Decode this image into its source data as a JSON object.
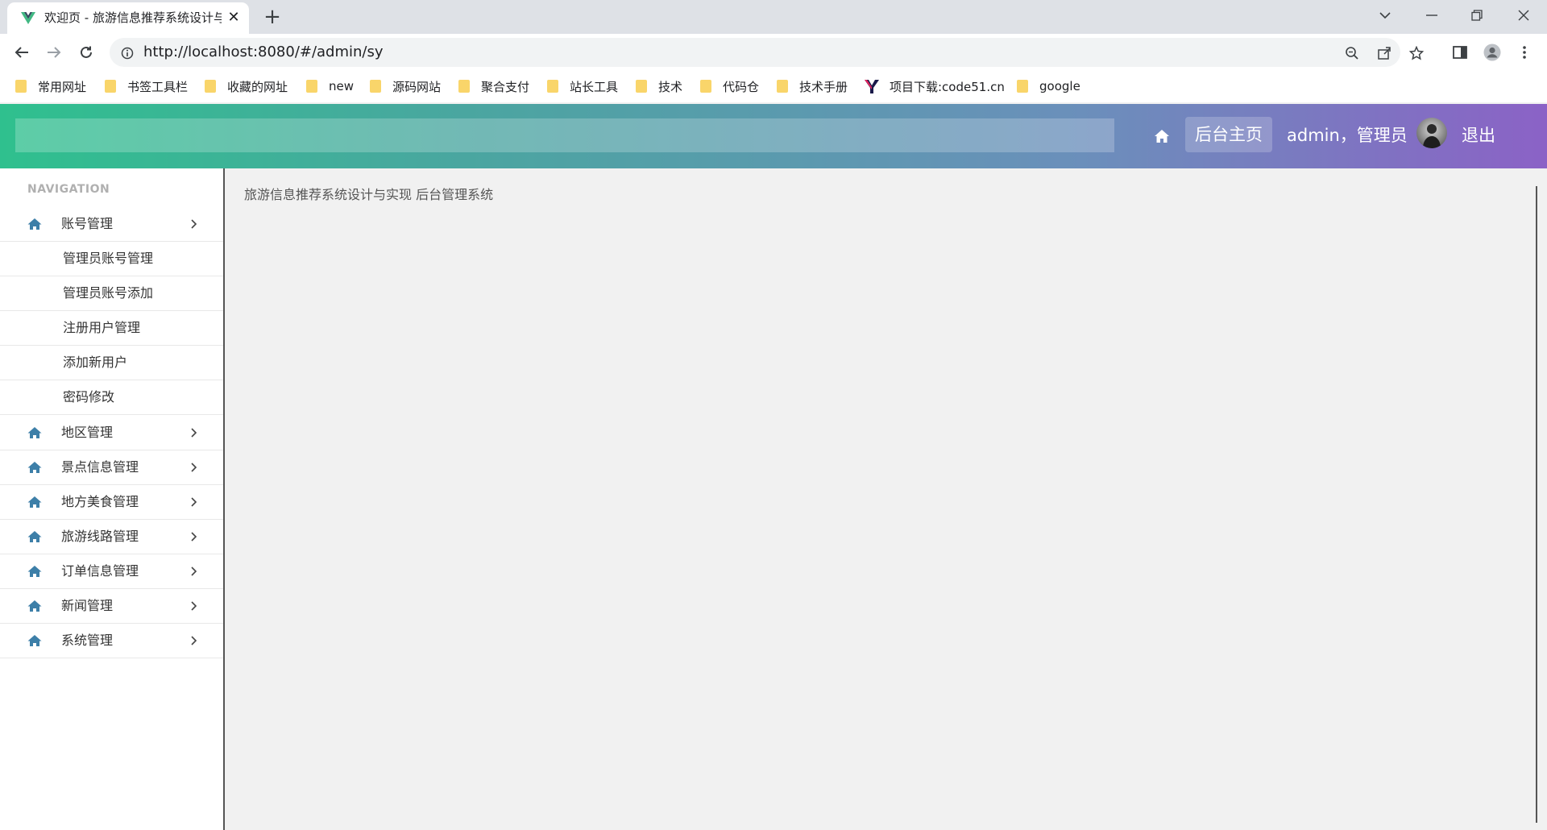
{
  "browser": {
    "tab_title": "欢迎页 - 旅游信息推荐系统设计与",
    "url": "http://localhost:8080/#/admin/sy",
    "bookmarks": [
      {
        "label": "常用网址",
        "icon": "folder-icon"
      },
      {
        "label": "书签工具栏",
        "icon": "folder-icon"
      },
      {
        "label": "收藏的网址",
        "icon": "folder-icon"
      },
      {
        "label": "new",
        "icon": "folder-icon"
      },
      {
        "label": "源码网站",
        "icon": "folder-icon"
      },
      {
        "label": "聚合支付",
        "icon": "folder-icon"
      },
      {
        "label": "站长工具",
        "icon": "folder-icon"
      },
      {
        "label": "技术",
        "icon": "folder-icon"
      },
      {
        "label": "代码仓",
        "icon": "folder-icon"
      },
      {
        "label": "技术手册",
        "icon": "folder-icon"
      },
      {
        "label": "项目下载:code51.cn",
        "icon": "site-logo-icon"
      },
      {
        "label": "google",
        "icon": "folder-icon"
      }
    ]
  },
  "header": {
    "home_label": "后台主页",
    "user_label": "admin，管理员",
    "logout_label": "退出",
    "gradient": [
      "#2fc08e",
      "#8b62c6"
    ]
  },
  "sidebar": {
    "heading": "NAVIGATION",
    "menus": [
      {
        "label": "账号管理",
        "expanded": true,
        "children": [
          "管理员账号管理",
          "管理员账号添加",
          "注册用户管理",
          "添加新用户",
          "密码修改"
        ]
      },
      {
        "label": "地区管理"
      },
      {
        "label": "景点信息管理"
      },
      {
        "label": "地方美食管理"
      },
      {
        "label": "旅游线路管理"
      },
      {
        "label": "订单信息管理"
      },
      {
        "label": "新闻管理"
      },
      {
        "label": "系统管理"
      }
    ]
  },
  "content": {
    "title": "旅游信息推荐系统设计与实现 后台管理系统"
  },
  "colors": {
    "menu_icon": "#3d7fa8",
    "folder": "#f9d56a"
  }
}
